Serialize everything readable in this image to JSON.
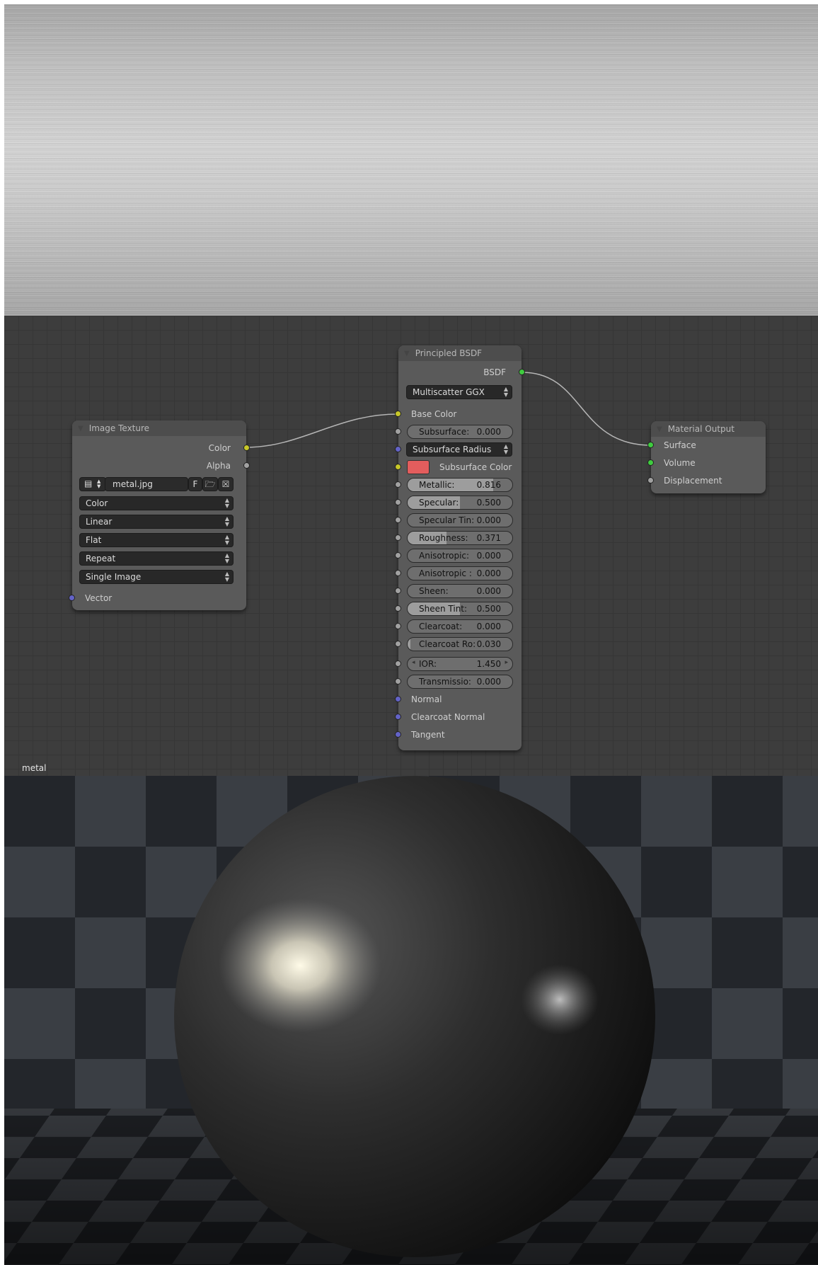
{
  "material_name": "metal",
  "image_texture_node": {
    "title": "Image Texture",
    "outputs": [
      "Color",
      "Alpha"
    ],
    "image": {
      "filename": "metal.jpg",
      "fake_user_label": "F"
    },
    "dropdowns": [
      "Color",
      "Linear",
      "Flat",
      "Repeat",
      "Single Image"
    ],
    "inputs": [
      "Vector"
    ]
  },
  "principled_node": {
    "title": "Principled BSDF",
    "output": "BSDF",
    "distribution": "Multiscatter GGX",
    "base_color_label": "Base Color",
    "subsurface_method": "Subsurface Radius",
    "subsurface_color_label": "Subsurface Color",
    "subsurface_color": "#e35d5d",
    "sliders": [
      {
        "label": "Subsurface:",
        "value": "0.000",
        "fraction": 0.0
      },
      {
        "label": "Metallic:",
        "value": "0.816",
        "fraction": 0.816
      },
      {
        "label": "Specular:",
        "value": "0.500",
        "fraction": 0.5
      },
      {
        "label": "Specular Tin:",
        "value": "0.000",
        "fraction": 0.0
      },
      {
        "label": "Roughness:",
        "value": "0.371",
        "fraction": 0.371
      },
      {
        "label": "Anisotropic:",
        "value": "0.000",
        "fraction": 0.0
      },
      {
        "label": "Anisotropic :",
        "value": "0.000",
        "fraction": 0.0
      },
      {
        "label": "Sheen:",
        "value": "0.000",
        "fraction": 0.0
      },
      {
        "label": "Sheen Tint:",
        "value": "0.500",
        "fraction": 0.5
      },
      {
        "label": "Clearcoat:",
        "value": "0.000",
        "fraction": 0.0
      },
      {
        "label": "Clearcoat Ro:",
        "value": "0.030",
        "fraction": 0.03
      }
    ],
    "ior": {
      "label": "IOR:",
      "value": "1.450"
    },
    "transmission": {
      "label": "Transmissio:",
      "value": "0.000",
      "fraction": 0.0
    },
    "vector_inputs": [
      "Normal",
      "Clearcoat Normal",
      "Tangent"
    ]
  },
  "material_output_node": {
    "title": "Material Output",
    "inputs": [
      "Surface",
      "Volume",
      "Displacement"
    ]
  },
  "colors": {
    "socket_color": "#c7c729",
    "socket_float": "#a1a1a1",
    "socket_vector": "#6363c7",
    "socket_shader": "#3fcc3f",
    "editor_bg": "#3d3d3d",
    "node_body": "#5a5a5a"
  }
}
